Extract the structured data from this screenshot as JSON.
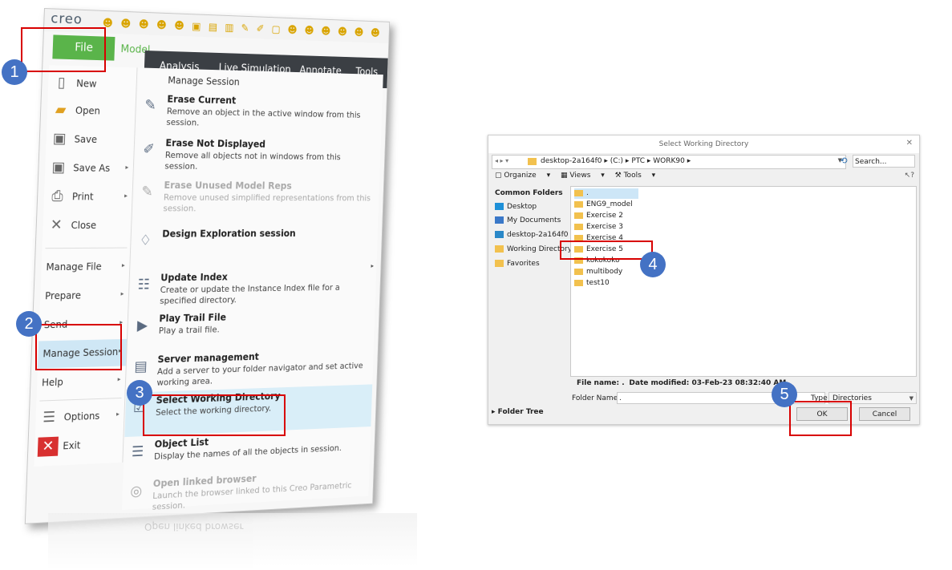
{
  "creo": {
    "logo": "creo",
    "file_tab": "File",
    "model_tab": "Model",
    "ribbon_tabs": [
      "Analysis",
      "Live Simulation",
      "Annotate",
      "Tools"
    ],
    "left_menu": [
      {
        "label": "New",
        "icon": "new-icon",
        "arrow": false
      },
      {
        "label": "Open",
        "icon": "folder-open-icon",
        "arrow": false
      },
      {
        "label": "Save",
        "icon": "save-icon",
        "arrow": false
      },
      {
        "label": "Save As",
        "icon": "save-as-icon",
        "arrow": true
      },
      {
        "label": "Print",
        "icon": "print-icon",
        "arrow": true
      },
      {
        "label": "Close",
        "icon": "close-icon",
        "arrow": false
      },
      {
        "label": "Manage File",
        "arrow": true
      },
      {
        "label": "Prepare",
        "arrow": true
      },
      {
        "label": "Send",
        "arrow": true
      },
      {
        "label": "Manage Session",
        "arrow": true,
        "selected": true
      },
      {
        "label": "Help",
        "arrow": true
      },
      {
        "label": "Options",
        "icon": "options-icon",
        "arrow": true
      },
      {
        "label": "Exit",
        "icon": "exit-icon",
        "arrow": false
      }
    ],
    "submenu_header": "Manage Session",
    "submenu": [
      {
        "title": "Erase Current",
        "desc": "Remove an object in the active window from this session.",
        "icon": "erase-current-icon"
      },
      {
        "title": "Erase Not Displayed",
        "desc": "Remove all objects not in windows from this session.",
        "icon": "erase-not-displayed-icon"
      },
      {
        "title": "Erase Unused Model Reps",
        "desc": "Remove unused simplified representations from this session.",
        "icon": "erase-reps-icon",
        "disabled": true
      },
      {
        "title": "Design Exploration session",
        "desc": "",
        "icon": "design-exploration-icon"
      },
      {
        "title": "Update Index",
        "desc": "Create or update the Instance Index file for a specified directory.",
        "icon": "update-index-icon"
      },
      {
        "title": "Play Trail File",
        "desc": "Play a trail file.",
        "icon": "play-trail-icon"
      },
      {
        "title": "Server management",
        "desc": "Add a server to your folder navigator and set active working area.",
        "icon": "server-icon"
      },
      {
        "title": "Select Working Directory",
        "desc": "Select the working directory.",
        "icon": "working-directory-icon",
        "selected": true
      },
      {
        "title": "Object List",
        "desc": "Display the names of all the objects in session.",
        "icon": "object-list-icon"
      },
      {
        "title": "Open linked browser",
        "desc": "Launch the browser linked to this Creo Parametric session.",
        "icon": "browser-icon",
        "disabled": true
      }
    ]
  },
  "dialog": {
    "title": "Select Working Directory",
    "path": [
      "desktop-2a164f0",
      "(C:)",
      "PTC",
      "WORK90"
    ],
    "search_placeholder": "Search...",
    "toolbar": {
      "organize": "Organize",
      "views": "Views",
      "tools": "Tools"
    },
    "sidebar_header": "Common Folders",
    "sidebar_items": [
      {
        "label": "Desktop",
        "color": "#1e90d8"
      },
      {
        "label": "My Documents",
        "color": "#3a78c8"
      },
      {
        "label": "desktop-2a164f0",
        "color": "#2a88c8"
      },
      {
        "label": "Working Directory",
        "color": "#f2c14e"
      },
      {
        "label": "Favorites",
        "color": "#f2c14e"
      }
    ],
    "folders": [
      ".",
      "ENG9_model",
      "Exercise 2",
      "Exercise 3",
      "Exercise 4",
      "Exercise 5",
      "kokokoko",
      "multibody",
      "test10"
    ],
    "info_name": "File name: .",
    "info_date": "Date modified: 03-Feb-23 08:32:40 AM",
    "folder_name_label": "Folder Name:",
    "folder_name_value": ".",
    "type_label": "Type",
    "type_value": "Directories",
    "folder_tree": "Folder Tree",
    "ok": "OK",
    "cancel": "Cancel"
  },
  "steps": [
    "1",
    "2",
    "3",
    "4",
    "5"
  ],
  "colors": {
    "highlight": "#d80000",
    "badge": "#4472c4",
    "file_tab": "#5ab44a"
  }
}
